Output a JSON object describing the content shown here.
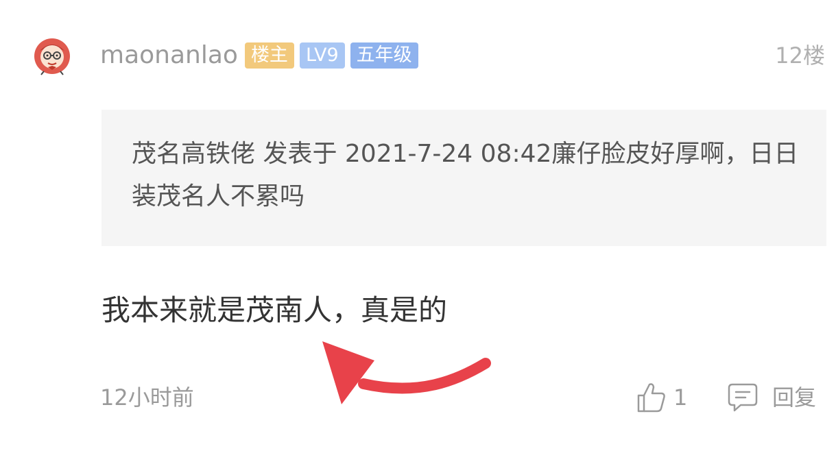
{
  "post": {
    "username": "maonanlao",
    "badges": {
      "owner": "楼主",
      "level": "LV9",
      "grade": "五年级"
    },
    "floor": "12楼",
    "quote": "茂名高铁佬 发表于 2021-7-24 08:42廉仔脸皮好厚啊，日日装茂名人不累吗",
    "content": "我本来就是茂南人，真是的",
    "time": "12小时前",
    "like_count": "1",
    "reply_label": "回复"
  },
  "icons": {
    "avatar": "cartoon-avatar",
    "like": "thumbs-up-icon",
    "reply": "comment-icon",
    "annotation": "red-arrow"
  },
  "colors": {
    "owner_badge": "#f2c97c",
    "level_badge": "#a8c6f4",
    "grade_badge": "#8eb2ee",
    "arrow": "#e8424a",
    "quote_bg": "#f5f5f5"
  }
}
